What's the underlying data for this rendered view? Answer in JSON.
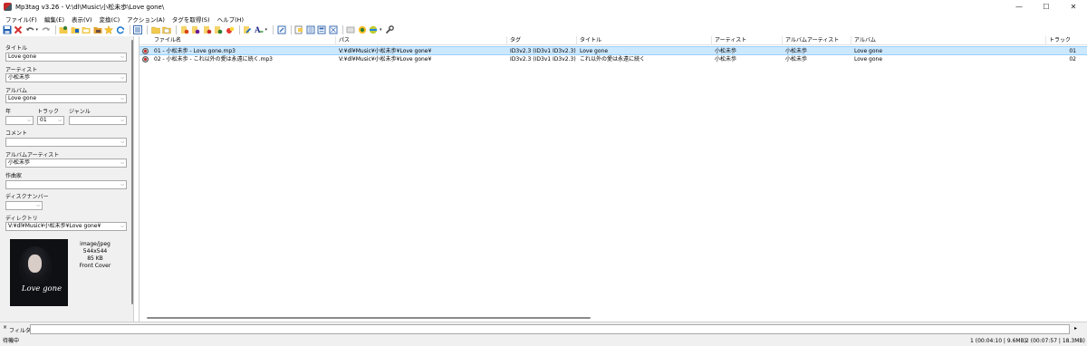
{
  "window": {
    "title": "Mp3tag v3.26  -  V:\\dl\\Music\\小松未歩\\Love gone\\",
    "minimize": "—",
    "maximize": "☐",
    "close": "✕"
  },
  "menu": [
    "ファイル(F)",
    "編集(E)",
    "表示(V)",
    "変換(C)",
    "アクション(A)",
    "タグを取得(S)",
    "ヘルプ(H)"
  ],
  "toolbar": {
    "icons": [
      "save-icon",
      "remove-tag-icon",
      "undo-icon",
      "redo-icon",
      "change-directory-icon",
      "add-directory-icon",
      "favorite-folder-icon",
      "favorites-icon",
      "refresh-icon",
      "list-view-icon",
      "folder-icon",
      "folder-open-icon",
      "tag-to-filename-icon",
      "filename-to-tag-icon",
      "tag-to-tag-icon",
      "text-file-icon",
      "actions-icon",
      "format-icon",
      "export-icon",
      "quick-action-icon",
      "playlist-icon",
      "tag-sources-icon",
      "web-source-icon",
      "tools-icon"
    ]
  },
  "tag_panel": {
    "title_label": "タイトル",
    "title_value": "Love gone",
    "artist_label": "アーティスト",
    "artist_value": "小松未歩",
    "album_label": "アルバム",
    "album_value": "Love gone",
    "year_label": "年",
    "year_value": "",
    "track_label": "トラック",
    "track_value": "01",
    "genre_label": "ジャンル",
    "genre_value": "",
    "comment_label": "コメント",
    "comment_value": "",
    "album_artist_label": "アルバムアーティスト",
    "album_artist_value": "小松未歩",
    "composer_label": "作曲家",
    "composer_value": "",
    "disc_label": "ディスクナンバー",
    "disc_value": "",
    "directory_label": "ディレクトリ",
    "directory_value": "V:¥dl¥Music¥小松未歩¥Love gone¥",
    "cover": {
      "mime": "image/jpeg",
      "dimensions": "544x544",
      "size": "85 KB",
      "type": "Front Cover",
      "art_title": "Love gone"
    }
  },
  "file_list": {
    "columns": [
      "ファイル名",
      "パス",
      "タグ",
      "タイトル",
      "アーティスト",
      "アルバムアーティスト",
      "アルバム",
      "トラック"
    ],
    "rows": [
      {
        "filename": "01 - 小松未歩 - Love gone.mp3",
        "path": "V:¥dl¥Music¥小松未歩¥Love gone¥",
        "tag": "ID3v2.3 (ID3v1 ID3v2.3)",
        "title": "Love gone",
        "artist": "小松未歩",
        "album_artist": "小松未歩",
        "album": "Love gone",
        "track": "01"
      },
      {
        "filename": "02 - 小松未歩 - これ以外の愛は永遠に続く.mp3",
        "path": "V:¥dl¥Music¥小松未歩¥Love gone¥",
        "tag": "ID3v2.3 (ID3v1 ID3v2.3)",
        "title": "これ以外の愛は永遠に続く",
        "artist": "小松未歩",
        "album_artist": "小松未歩",
        "album": "Love gone",
        "track": "02"
      }
    ]
  },
  "filter": {
    "close": "×",
    "label": "フィルター:",
    "value": "",
    "go": "▸"
  },
  "status": {
    "left": "待機中",
    "selected": "1 (00:04:10 | 9.6MB)",
    "total": "2 (00:07:57 | 18.3MB)"
  },
  "colors": {
    "selection": "#cce8ff",
    "selection_border": "#99d1ff",
    "window_bg": "#f0f0f0"
  }
}
